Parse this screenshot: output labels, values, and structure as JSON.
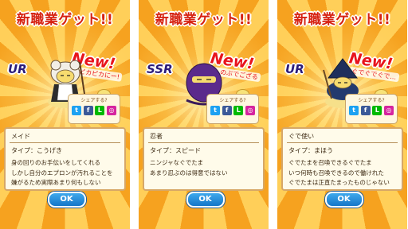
{
  "screens": [
    {
      "title": "新職業ゲット!!",
      "rank": "UR",
      "new_badge": "New!",
      "catchphrase": "ピカピカにー!",
      "share_label": "シェアする?",
      "job_name": "メイド",
      "job_type": "タイプ：こうげき",
      "description": [
        "身の回りのお手伝いをしてくれる",
        "しかし自分のエプロンが汚れることを",
        "嫌がるため実際あまり何もしない"
      ],
      "ok_label": "OK"
    },
    {
      "title": "新職業ゲット!!",
      "rank": "SSR",
      "new_badge": "New!",
      "catchphrase": "しのぶでござる",
      "share_label": "シェアする?",
      "job_name": "忍者",
      "job_type": "タイプ：スピード",
      "description": [
        "ニンジャなぐでたま",
        "あまり忍ぶのは得意ではない"
      ],
      "ok_label": "OK"
    },
    {
      "title": "新職業ゲット!!",
      "rank": "UR",
      "new_badge": "New!",
      "catchphrase": "ぐでぐでぐで…",
      "share_label": "シェアする?",
      "job_name": "ぐで使い",
      "job_type": "タイプ：まほう",
      "description": [
        "ぐでたまを召喚できるぐでたま",
        "いつ何時も召喚できるので働けれた",
        "ぐでたまは正直たまったものじゃない"
      ],
      "ok_label": "OK"
    }
  ],
  "share_icons": [
    "twitter-icon",
    "facebook-icon",
    "line-icon",
    "instagram-icon"
  ],
  "colors": {
    "title_red": "#d62211",
    "rank_navy": "#2b1c7a",
    "new_red": "#e8141c",
    "ok_blue": "#1476c8",
    "ray_orange": "#f6a21f",
    "ray_yellow": "#ffcf59"
  }
}
